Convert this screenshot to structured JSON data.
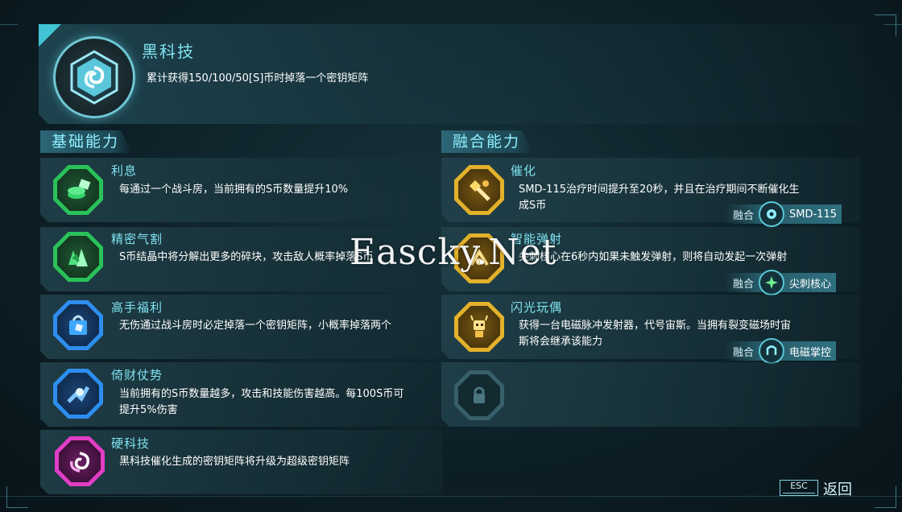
{
  "header": {
    "title": "黑科技",
    "description": "累计获得150/100/50[S]币时掉落一个密钥矩阵",
    "icon": "black-tech-hex-icon"
  },
  "basic": {
    "tab": "基础能力",
    "items": [
      {
        "name": "利息",
        "desc": "每通过一个战斗房，当前拥有的S币数量提升10%",
        "icon": "coin-stack-icon",
        "rarity": "green"
      },
      {
        "name": "精密气割",
        "desc": "S币结晶中将分解出更多的碎块，攻击敌人概率掉落S币",
        "icon": "crystal-shards-icon",
        "rarity": "green"
      },
      {
        "name": "高手福利",
        "desc": "无伤通过战斗房时必定掉落一个密钥矩阵，小概率掉落两个",
        "icon": "gift-bag-icon",
        "rarity": "blue"
      },
      {
        "name": "倚财仗势",
        "desc": "当前拥有的S币数量越多，攻击和技能伤害越高。每100S币可提升5%伤害",
        "icon": "power-arm-icon",
        "rarity": "blue"
      },
      {
        "name": "硬科技",
        "desc": "黑科技催化生成的密钥矩阵将升级为超级密钥矩阵",
        "icon": "swirl-core-icon",
        "rarity": "purple"
      }
    ]
  },
  "fusion": {
    "tab": "融合能力",
    "items": [
      {
        "name": "催化",
        "desc": "SMD-115治疗时间提升至20秒，并且在治疗期间不断催化生成S币",
        "icon": "catalyst-tool-icon",
        "fuse_label": "融合",
        "fuse_name": "SMD-115",
        "fuse_icon": "drone-icon"
      },
      {
        "name": "智能弹射",
        "desc": "尖刺核心在6秒内如果未触发弹射，则将自动发起一次弹射",
        "icon": "bounce-arrow-icon",
        "fuse_label": "融合",
        "fuse_name": "尖刺核心",
        "fuse_icon": "spike-core-icon"
      },
      {
        "name": "闪光玩偶",
        "desc": "获得一台电磁脉冲发射器，代号宙斯。当拥有裂变磁场时宙斯将会继承该能力",
        "icon": "robot-doll-icon",
        "fuse_label": "融合",
        "fuse_name": "电磁掌控",
        "fuse_icon": "magnet-hand-icon"
      }
    ],
    "locked_slot_icon": "lock-icon"
  },
  "footer": {
    "esc_label": "ESC",
    "back_label": "返回"
  },
  "watermark": "Eascky.Net",
  "colors": {
    "accent": "#7fe3f0",
    "green": "#29c25a",
    "blue": "#2d8ef0",
    "purple": "#e13ec7",
    "gold": "#e3b12a"
  }
}
